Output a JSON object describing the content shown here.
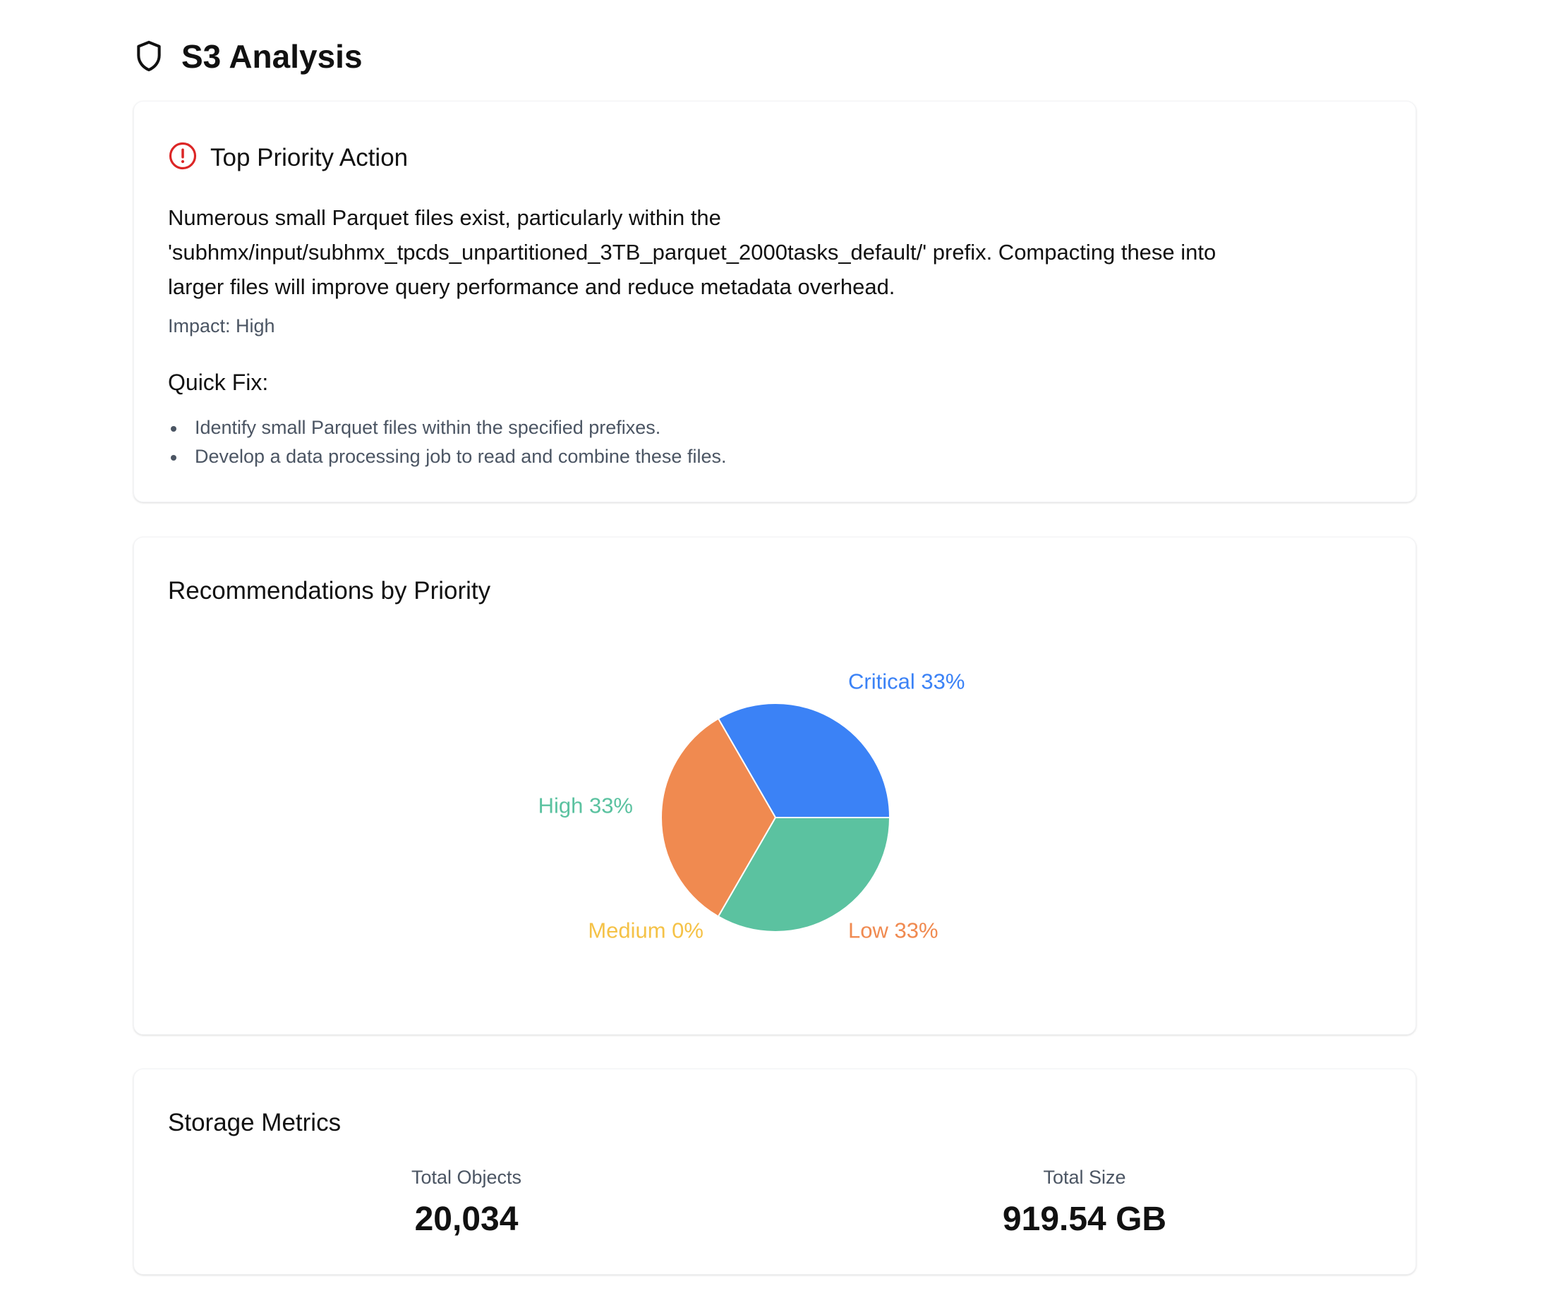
{
  "header": {
    "title": "S3 Analysis",
    "icon": "shield-icon"
  },
  "top_priority": {
    "heading": "Top Priority Action",
    "icon": "alert-circle-icon",
    "icon_color": "#dc2626",
    "description_lines": [
      "Numerous small Parquet files exist, particularly within the",
      "'subhmx/input/subhmx_tpcds_unpartitioned_3TB_parquet_2000tasks_default/' prefix. Compacting these into",
      "larger files will improve query performance and reduce metadata overhead."
    ],
    "impact": "Impact: High",
    "quick_fix_title": "Quick Fix:",
    "quick_fix_items": [
      "Identify small Parquet files within the specified prefixes.",
      "Develop a data processing job to read and combine these files."
    ]
  },
  "recommendations": {
    "heading": "Recommendations by Priority"
  },
  "chart_data": {
    "type": "pie",
    "title": "Recommendations by Priority",
    "slices": [
      {
        "label": "Critical",
        "value": 33,
        "display": "Critical 33%",
        "color": "#3b82f6"
      },
      {
        "label": "Low",
        "value": 33,
        "display": "Low 33%",
        "color": "#f08a50"
      },
      {
        "label": "Medium",
        "value": 0,
        "display": "Medium 0%",
        "color": "#f5c247"
      },
      {
        "label": "High",
        "value": 33,
        "display": "High 33%",
        "color": "#5bc2a0"
      }
    ],
    "start_angle_deg": 0,
    "direction": "clockwise"
  },
  "storage_metrics": {
    "heading": "Storage Metrics",
    "total_objects_label": "Total Objects",
    "total_objects_value": "20,034",
    "total_size_label": "Total Size",
    "total_size_value": "919.54 GB"
  }
}
